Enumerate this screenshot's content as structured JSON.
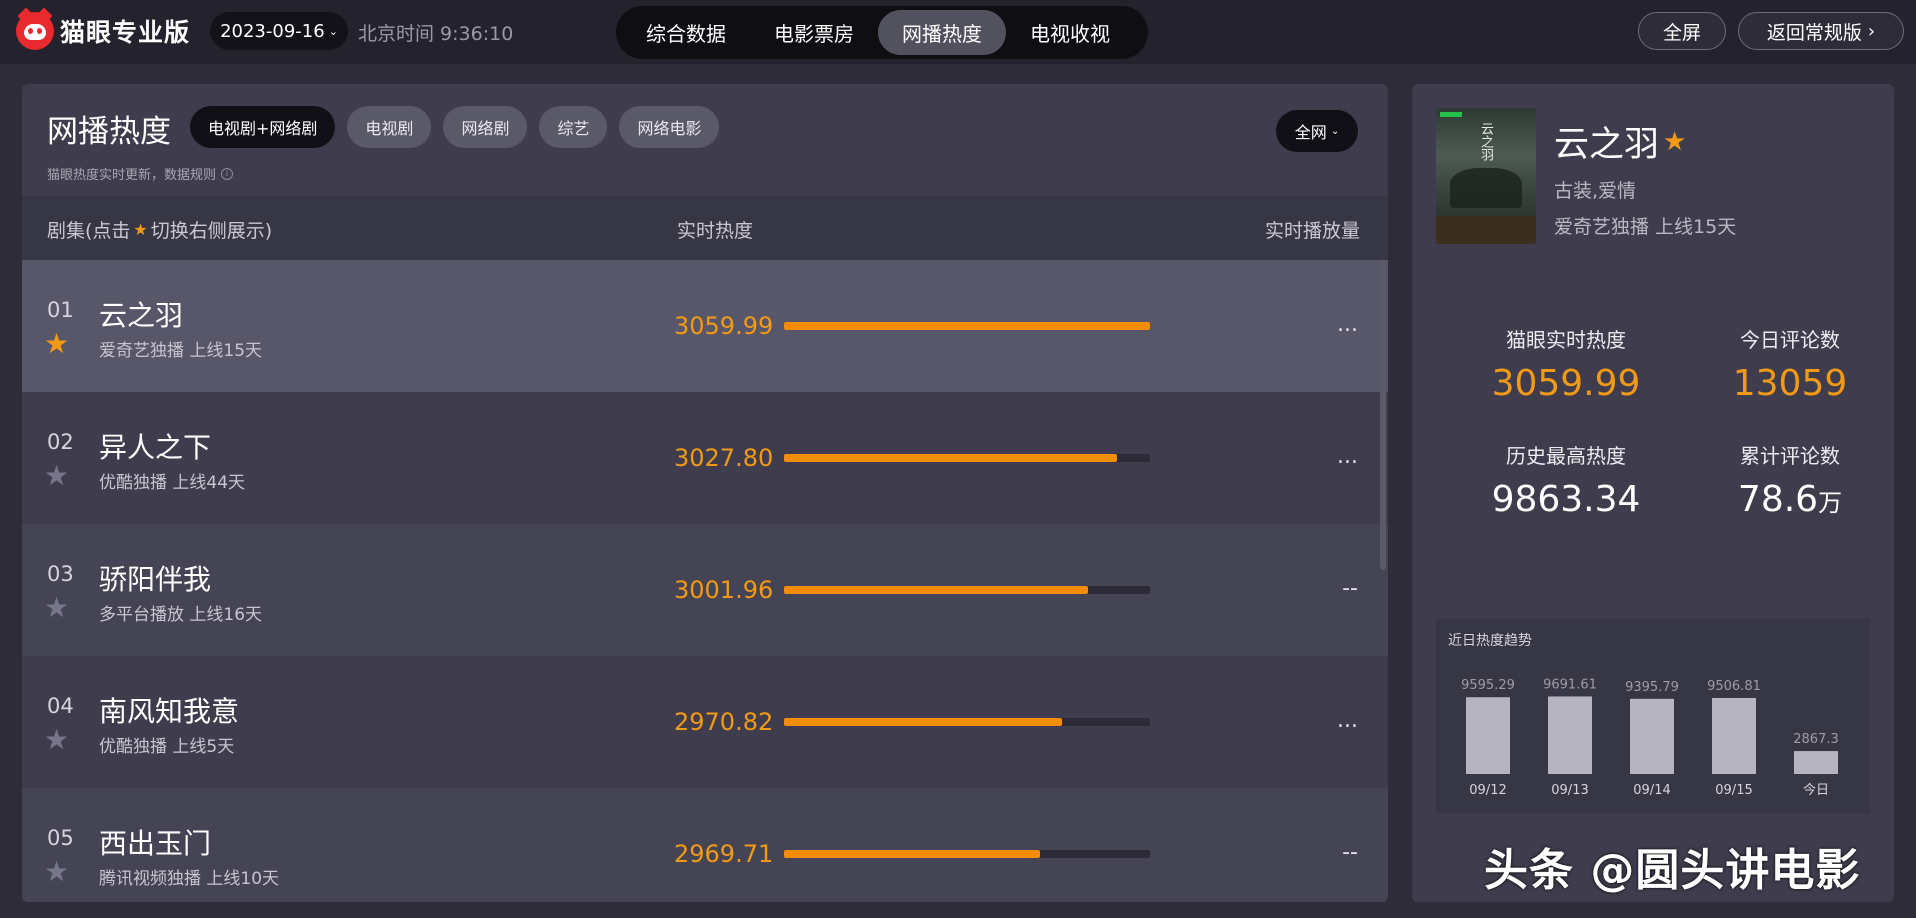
{
  "header": {
    "brand": "猫眼专业版",
    "date": "2023-09-16",
    "clock": "北京时间 9:36:10",
    "tabs": [
      {
        "label": "综合数据",
        "active": false
      },
      {
        "label": "电影票房",
        "active": false
      },
      {
        "label": "网播热度",
        "active": true
      },
      {
        "label": "电视收视",
        "active": false
      }
    ],
    "fullscreen": "全屏",
    "back": "返回常规版"
  },
  "panel": {
    "title": "网播热度",
    "filters": [
      {
        "label": "电视剧+网络剧",
        "active": true
      },
      {
        "label": "电视剧",
        "active": false
      },
      {
        "label": "网络剧",
        "active": false
      },
      {
        "label": "综艺",
        "active": false
      },
      {
        "label": "网络电影",
        "active": false
      }
    ],
    "scope": "全网",
    "note": "猫眼热度实时更新，数据规则",
    "columns": {
      "col1_pre": "剧集(点击",
      "col1_post": "切换右侧展示)",
      "col2": "实时热度",
      "col3": "实时播放量"
    },
    "rows": [
      {
        "rank": "01",
        "name": "云之羽",
        "meta": "爱奇艺独播  上线15天",
        "heat": "3059.99",
        "fill": 1.0,
        "plays": "...",
        "starred": true
      },
      {
        "rank": "02",
        "name": "异人之下",
        "meta": "优酷独播  上线44天",
        "heat": "3027.80",
        "fill": 0.91,
        "plays": "...",
        "starred": false
      },
      {
        "rank": "03",
        "name": "骄阳伴我",
        "meta": "多平台播放  上线16天",
        "heat": "3001.96",
        "fill": 0.83,
        "plays": "--",
        "starred": false
      },
      {
        "rank": "04",
        "name": "南风知我意",
        "meta": "优酷独播  上线5天",
        "heat": "2970.82",
        "fill": 0.76,
        "plays": "...",
        "starred": false
      },
      {
        "rank": "05",
        "name": "西出玉门",
        "meta": "腾讯视频独播  上线10天",
        "heat": "2969.71",
        "fill": 0.7,
        "plays": "--",
        "starred": false
      }
    ]
  },
  "detail": {
    "title": "云之羽",
    "genre": "古装,爱情",
    "meta": "爱奇艺独播  上线15天",
    "poster_text": "云之羽",
    "stats": {
      "realtime_label": "猫眼实时热度",
      "realtime_value": "3059.99",
      "today_comments_label": "今日评论数",
      "today_comments_value": "13059",
      "peak_label": "历史最高热度",
      "peak_value": "9863.34",
      "total_comments_label": "累计评论数",
      "total_comments_value": "78.6",
      "total_comments_unit": "万"
    },
    "trend_title": "近日热度趋势"
  },
  "chart_data": {
    "type": "bar",
    "title": "近日热度趋势",
    "categories": [
      "09/12",
      "09/13",
      "09/14",
      "09/15",
      "今日"
    ],
    "values": [
      9595.29,
      9691.61,
      9395.79,
      9506.81,
      2867.3
    ],
    "value_labels": [
      "9595.29",
      "9691.61",
      "9395.79",
      "9506.81",
      "2867.3"
    ],
    "ylim": [
      0,
      10000
    ],
    "grid": false,
    "bar_color": "#b5b4bf"
  },
  "watermark": "头条 @圆头讲电影",
  "colors": {
    "accent": "#f29a16",
    "bar": "#f28c0a",
    "bg": "#2d2c38",
    "panel": "#3f3d4d"
  }
}
